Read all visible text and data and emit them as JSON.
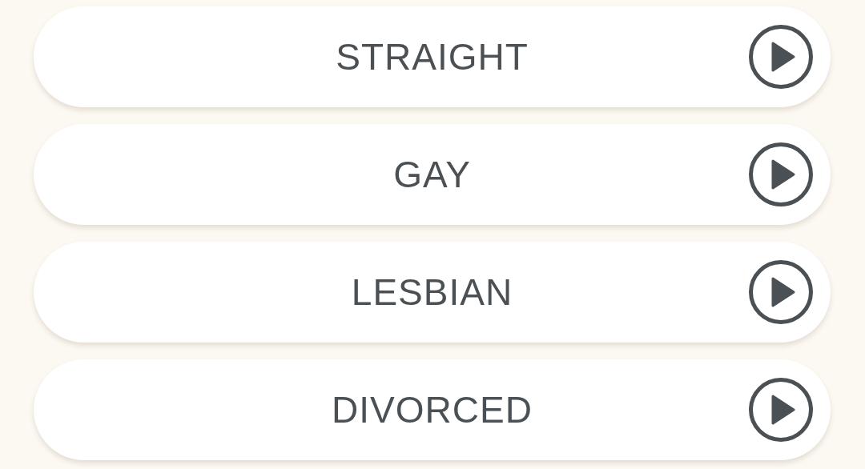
{
  "options": [
    {
      "label": "STRAIGHT"
    },
    {
      "label": "GAY"
    },
    {
      "label": "LESBIAN"
    },
    {
      "label": "DIVORCED"
    }
  ]
}
